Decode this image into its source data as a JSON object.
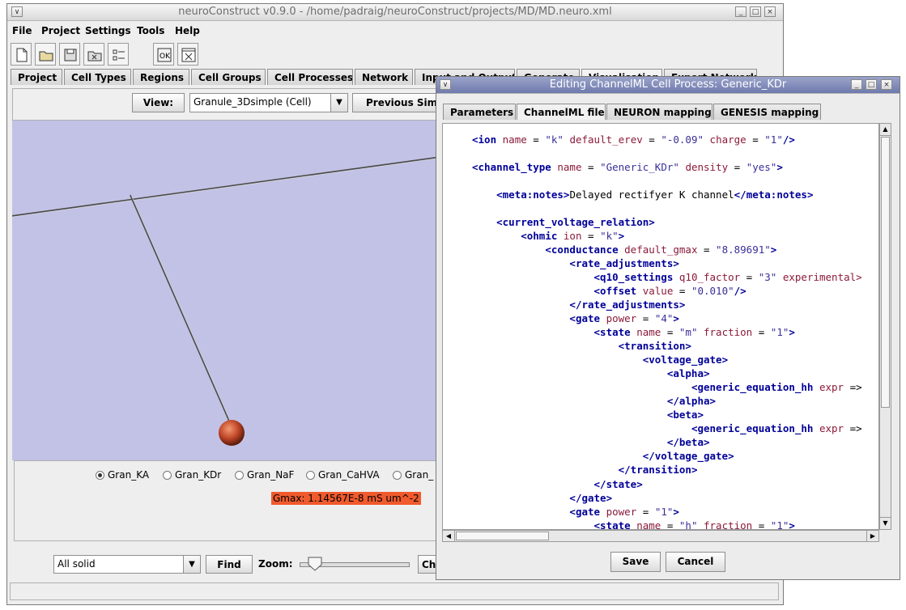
{
  "main_window": {
    "title": "neuroConstruct v0.9.0 - /home/padraig/neuroConstruct/projects/MD/MD.neuro.xml",
    "menu": [
      "File",
      "Project",
      "Settings",
      "Tools",
      "Help"
    ],
    "toolbar_icons": [
      "new-project-icon",
      "open-project-icon",
      "save-project-icon",
      "close-project-icon",
      "options-icon",
      "validate-icon",
      "close-icon"
    ],
    "tabs": [
      "Project",
      "Cell Types",
      "Regions",
      "Cell Groups",
      "Cell Processes",
      "Network",
      "Input and Output",
      "Generate",
      "Visualisation",
      "Export Network"
    ],
    "active_tab": "Visualisation",
    "view_label": "View:",
    "view_select": "Granule_3Dsimple (Cell)",
    "previous_sim_label": "Previous Simu",
    "radio_options": [
      "Gran_KA",
      "Gran_KDr",
      "Gran_NaF",
      "Gran_CaHVA",
      "Gran_"
    ],
    "selected_radio": "Gran_KA",
    "gmax_label": "Gmax: 1.14567E-8 mS um^-2",
    "display_select": "All solid",
    "find_label": "Find",
    "zoom_label": "Zoom:",
    "zoom_level": 0.08,
    "right_button_label": "Ch"
  },
  "dialog": {
    "title": "Editing ChannelML Cell Process: Generic_KDr",
    "tabs": [
      "Parameters",
      "ChannelML file",
      "NEURON mapping",
      "GENESIS mapping"
    ],
    "active_tab": "ChannelML file",
    "save_label": "Save",
    "cancel_label": "Cancel",
    "code_lines": [
      "<ion name = \"k\" default_erev = \"-0.09\" charge = \"1\"/>",
      "",
      "<channel_type name = \"Generic_KDr\" density = \"yes\">",
      "",
      "    <meta:notes>Delayed rectifyer K channel</meta:notes>",
      "",
      "    <current_voltage_relation>",
      "        <ohmic ion = \"k\">",
      "            <conductance default_gmax = \"8.89691\">",
      "                <rate_adjustments>",
      "                    <q10_settings q10_factor = \"3\" experimental",
      "                    <offset value = \"0.010\"/>",
      "                </rate_adjustments>",
      "                <gate power = \"4\">",
      "                    <state name = \"m\" fraction = \"1\">",
      "                        <transition>",
      "                            <voltage_gate>",
      "                                <alpha>",
      "                                    <generic_equation_hh expr =",
      "                                </alpha>",
      "                                <beta>",
      "                                    <generic_equation_hh expr =",
      "                                </beta>",
      "                            </voltage_gate>",
      "                        </transition>",
      "                    </state>",
      "                </gate>",
      "                <gate power = \"1\">",
      "                    <state name = \"h\" fraction = \"1\">"
    ]
  }
}
